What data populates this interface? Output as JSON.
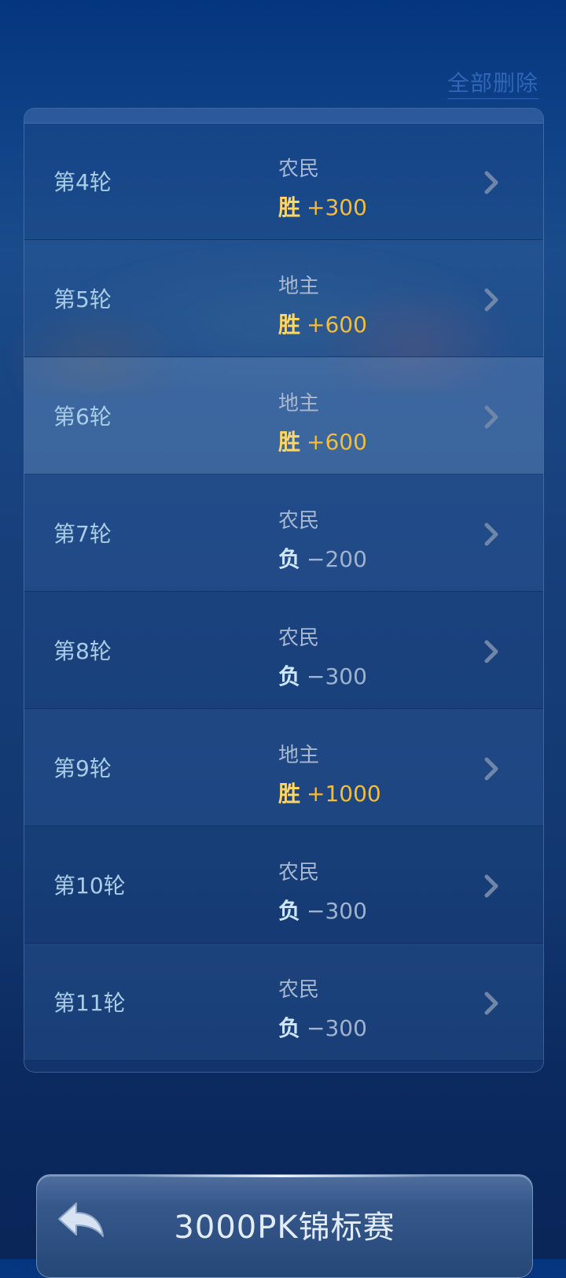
{
  "header": {
    "delete_all_label": "全部删除"
  },
  "rounds": [
    {
      "round": "第4轮",
      "role": "农民",
      "outcome": "胜",
      "score": "+300",
      "result": "win"
    },
    {
      "round": "第5轮",
      "role": "地主",
      "outcome": "胜",
      "score": "+600",
      "result": "win"
    },
    {
      "round": "第6轮",
      "role": "地主",
      "outcome": "胜",
      "score": "+600",
      "result": "win"
    },
    {
      "round": "第7轮",
      "role": "农民",
      "outcome": "负",
      "score": "−200",
      "result": "lose"
    },
    {
      "round": "第8轮",
      "role": "农民",
      "outcome": "负",
      "score": "−300",
      "result": "lose"
    },
    {
      "round": "第9轮",
      "role": "地主",
      "outcome": "胜",
      "score": "+1000",
      "result": "win"
    },
    {
      "round": "第10轮",
      "role": "农民",
      "outcome": "负",
      "score": "−300",
      "result": "lose"
    },
    {
      "round": "第11轮",
      "role": "农民",
      "outcome": "负",
      "score": "−300",
      "result": "lose"
    }
  ],
  "footer": {
    "title": "3000PK锦标赛",
    "back_icon": "back-arrow-icon"
  },
  "colors": {
    "win": "#f2bd3a",
    "lose": "#9fb3cf",
    "accent_link": "#2f66b8"
  }
}
